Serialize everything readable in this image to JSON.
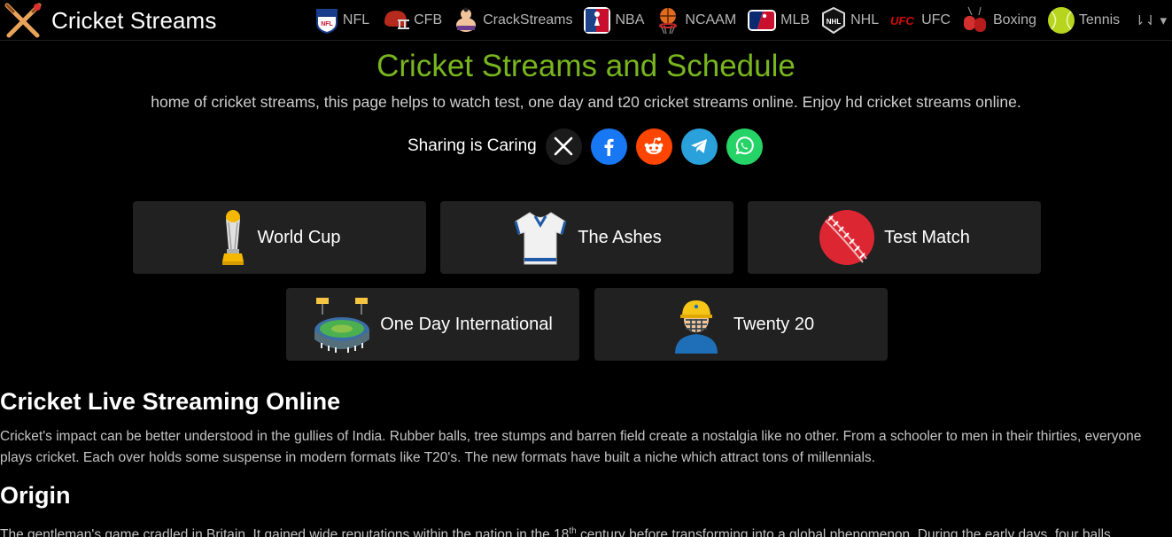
{
  "brand": {
    "name": "Cricket Streams"
  },
  "nav": {
    "items": [
      {
        "label": "NFL"
      },
      {
        "label": "CFB"
      },
      {
        "label": "CrackStreams"
      },
      {
        "label": "NBA"
      },
      {
        "label": "NCAAM"
      },
      {
        "label": "MLB"
      },
      {
        "label": "NHL"
      },
      {
        "label": "UFC"
      },
      {
        "label": "Boxing"
      },
      {
        "label": "Tennis"
      }
    ],
    "more_label": "⇂⇃ ▾"
  },
  "hero": {
    "title": "Cricket Streams and Schedule",
    "subtitle": "home of cricket streams, this page helps to watch test, one day and t20 cricket streams online. Enjoy hd cricket streams online."
  },
  "share": {
    "label": "Sharing is Caring",
    "buttons": [
      {
        "icon": "x-icon",
        "color": "#1b1b1b"
      },
      {
        "icon": "facebook-icon",
        "color": "#1877f2"
      },
      {
        "icon": "reddit-icon",
        "color": "#ff4500"
      },
      {
        "icon": "telegram-icon",
        "color": "#2aa1da"
      },
      {
        "icon": "whatsapp-icon",
        "color": "#25d366"
      }
    ]
  },
  "categories": [
    {
      "label": "World Cup",
      "icon": "trophy-icon"
    },
    {
      "label": "The Ashes",
      "icon": "jersey-icon"
    },
    {
      "label": "Test Match",
      "icon": "cricket-ball-icon"
    },
    {
      "label": "One Day International",
      "icon": "stadium-icon"
    },
    {
      "label": "Twenty 20",
      "icon": "batsman-helmet-icon"
    }
  ],
  "article": {
    "heading_1": "Cricket Live Streaming Online",
    "para_1_line_1": "Cricket's impact can be better understood in the gullies of India. Rubber balls, tree stumps and barren field create a nostalgia like no other. From a schooler to men in their thirties, everyone",
    "para_1_line_2": "plays cricket. Each over holds some suspense in modern formats like T20's. The new formats have built a niche which attract tons of millennials.",
    "heading_2": "Origin",
    "para_2_before_sup": "The gentleman's game cradled in Britain. It gained wide reputations within the nation in the 18",
    "para_2_sup": "th",
    "para_2_after_sup": " century before transforming into a global phenomenon. During the early days, four balls"
  },
  "colors": {
    "accent_green": "#78b51e",
    "card_bg": "#212121",
    "page_bg": "#000000"
  }
}
